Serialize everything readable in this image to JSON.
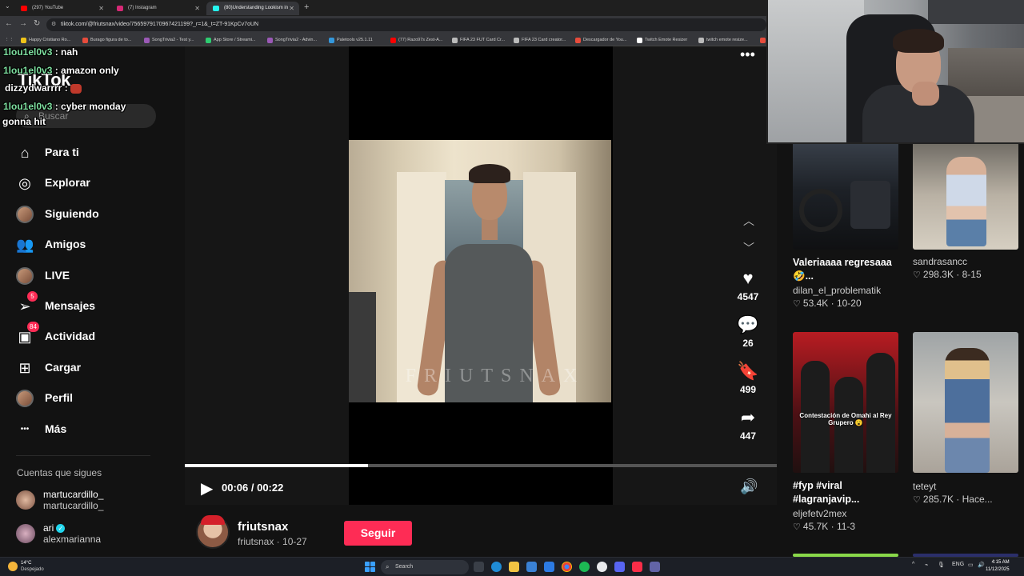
{
  "browser": {
    "tabs": [
      {
        "label": "(297) YouTube",
        "color": "#ff0000",
        "active": false
      },
      {
        "label": "(7) Instagram",
        "color": "#d62976",
        "active": false
      },
      {
        "label": "(80)Understanding Lookism in",
        "color": "#25f4ee",
        "active": true
      }
    ],
    "new_tab": "+",
    "url": "tiktok.com/@friutsnax/video/7565979170967421199?_r=1&_t=ZT-91KpCv7oUN",
    "bookmarks": [
      {
        "label": "Happy Cristiano Ro...",
        "color": "#f0c419"
      },
      {
        "label": "Burago figura de to...",
        "color": "#e74c3c"
      },
      {
        "label": "SongTrivia2 - Test y...",
        "color": "#9b59b6"
      },
      {
        "label": "App Store / Streami...",
        "color": "#2ecc71"
      },
      {
        "label": "SongTrivia2 - Advin...",
        "color": "#9b59b6"
      },
      {
        "label": "Paletools v25.1.11",
        "color": "#3498db"
      },
      {
        "label": "(77) Razo97s Zest-A...",
        "color": "#ff0000"
      },
      {
        "label": "FIFA 23 FUT Card Cr...",
        "color": "#bbbbbb"
      },
      {
        "label": "FIFA 23 Card creator...",
        "color": "#bbbbbb"
      },
      {
        "label": "Descargador de You...",
        "color": "#e74c3c"
      },
      {
        "label": "Twitch Emote Resizer",
        "color": "#ffffff"
      },
      {
        "label": "twitch emote resize...",
        "color": "#bbbbbb"
      },
      {
        "label": "Es",
        "color": "#e74c3c"
      }
    ]
  },
  "tiktok": {
    "logo": "TikTok",
    "search_placeholder": "Buscar",
    "nav": [
      {
        "label": "Para ti",
        "icon": "home-icon"
      },
      {
        "label": "Explorar",
        "icon": "compass-icon"
      },
      {
        "label": "Siguiendo",
        "icon": "avatar-icon"
      },
      {
        "label": "Amigos",
        "icon": "friends-icon"
      },
      {
        "label": "LIVE",
        "icon": "avatar-icon"
      },
      {
        "label": "Mensajes",
        "icon": "send-icon",
        "badge": "5"
      },
      {
        "label": "Actividad",
        "icon": "inbox-icon",
        "badge": "84"
      },
      {
        "label": "Cargar",
        "icon": "plus-icon"
      },
      {
        "label": "Perfil",
        "icon": "avatar-icon"
      },
      {
        "label": "Más",
        "icon": "more-icon"
      }
    ],
    "following_title": "Cuentas que sigues",
    "following": [
      {
        "name": "martucardillo_",
        "handle": "martucardillo_",
        "verified": false
      },
      {
        "name": "ari",
        "handle": "alexmarianna",
        "verified": true
      }
    ],
    "video": {
      "watermark": "FRIUTSNAX",
      "likes": "4547",
      "comments": "26",
      "saves": "499",
      "shares": "447",
      "time": "00:06 / 00:22",
      "progress": 0.31
    },
    "author": {
      "name": "friutsnax",
      "sub": "friutsnax · 10-27",
      "follow_label": "Seguir"
    },
    "suggested": [
      {
        "title": "Valeriaaaa regresaaa 🤣...",
        "user": "dilan_el_problematik",
        "meta": "53.4K · 10-20"
      },
      {
        "title": "",
        "user": "sandrasancc",
        "meta": "298.3K · 8-15"
      },
      {
        "title": "#fyp #viral #lagranjavip...",
        "user": "eljefetv2mex",
        "meta": "45.7K · 11-3",
        "caption": "Contestación de Omahi al Rey Grupero 😮"
      },
      {
        "title": "",
        "user": "teteyt",
        "meta": "285.7K · Hace..."
      }
    ]
  },
  "chat": [
    {
      "user": "1lou1el0v3",
      "msg": " : nah"
    },
    {
      "user": "1lou1el0v3",
      "msg": " : amazon only"
    },
    {
      "user": "dizzydwarrrr",
      "msg": " : "
    },
    {
      "user": "1lou1el0v3",
      "msg": " : cyber monday"
    },
    {
      "user": "",
      "msg": "gonna hit"
    }
  ],
  "taskbar": {
    "weather_temp": "14°C",
    "weather_desc": "Despejado",
    "search": "Search",
    "lang": "ENG",
    "time": "4:15 AM",
    "date": "11/12/2025"
  }
}
